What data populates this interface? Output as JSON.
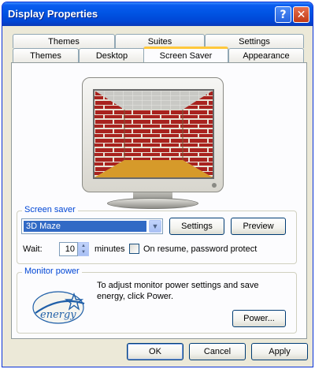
{
  "window": {
    "title": "Display Properties",
    "help_glyph": "?",
    "close_glyph": "✕"
  },
  "tabs": {
    "back_row": [
      "Themes",
      "Suites",
      "Settings"
    ],
    "front_row": [
      "Themes",
      "Desktop",
      "Screen Saver",
      "Appearance"
    ],
    "active": "Screen Saver"
  },
  "screen_saver": {
    "group_label": "Screen saver",
    "selected": "3D Maze",
    "settings_button": "Settings",
    "preview_button": "Preview",
    "wait_label": "Wait:",
    "wait_value": "10",
    "minutes_label": "minutes",
    "password_label": "On resume, password protect",
    "password_checked": false
  },
  "monitor_power": {
    "group_label": "Monitor power",
    "description": "To adjust monitor power settings and save energy, click Power.",
    "power_button": "Power...",
    "logo_text": "energy"
  },
  "dialog_buttons": {
    "ok": "OK",
    "cancel": "Cancel",
    "apply": "Apply"
  },
  "colors": {
    "titlebar": "#0054e3",
    "dialog_bg": "#ece9d8",
    "tab_highlight": "#ffc83c",
    "group_label": "#0046d5",
    "selection": "#316ac5",
    "brick": "#a8221e",
    "maze_floor": "#d69a2a"
  },
  "icons": [
    "help-icon",
    "close-icon",
    "dropdown-arrow-icon",
    "spin-up-icon",
    "spin-down-icon",
    "energy-star-logo"
  ]
}
